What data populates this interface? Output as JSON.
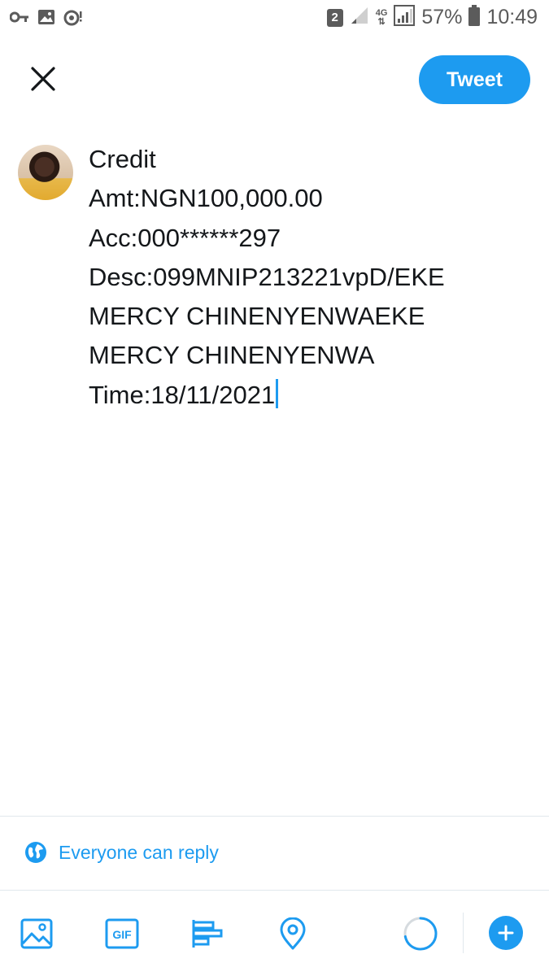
{
  "status_bar": {
    "sim_slot": "2",
    "network_type": "4G",
    "battery_percent": "57%",
    "time": "10:49",
    "left_icons": [
      "key-icon",
      "image-notification-icon",
      "sync-alert-icon"
    ],
    "right_icons": [
      "sim-badge",
      "signal-weak-icon",
      "network-type-icon",
      "signal-icon",
      "battery-icon"
    ]
  },
  "header": {
    "close_icon": "close-icon",
    "tweet_label": "Tweet"
  },
  "compose": {
    "lines": [
      "Credit",
      "Amt:NGN100,000.00",
      "Acc:000******297",
      "Desc:099MNIP213221vpD/EKE",
      "MERCY CHINENYENWAEKE",
      "MERCY CHINENYENWA",
      "Time:18/11/2021"
    ]
  },
  "reply_setting": {
    "label": "Everyone can reply",
    "icon": "globe-icon"
  },
  "toolbar": {
    "items": [
      "image-icon",
      "gif-icon",
      "poll-icon",
      "location-icon"
    ],
    "gif_text": "GIF",
    "character_progress": 0.72,
    "add_icon": "plus-icon"
  },
  "colors": {
    "accent": "#1d9bf0",
    "text": "#14171a",
    "divider": "#e1e8ed",
    "status_gray": "#5b5b5b"
  }
}
